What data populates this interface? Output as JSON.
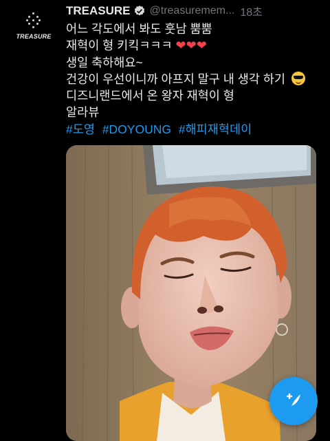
{
  "avatar": {
    "logo_text": "TREASURE"
  },
  "tweet": {
    "name": "TREASURE",
    "handle": "@treasuremem...",
    "time": "18초",
    "lines": [
      "어느 각도에서 봐도 훗남 뿜뿜",
      "재혁이 형 키킥ㅋㅋㅋ",
      "생일 축하해요~",
      "건강이 우선이니까 아프지 말구 내 생각 하기",
      "디즈니랜드에서 온 왕자 재혁이 형",
      "알라뷰"
    ],
    "hashtags": [
      "#도영",
      "#DOYOUNG",
      "#해피재혁데이"
    ]
  },
  "colors": {
    "accent": "#1d9bf0",
    "heart": "#f4414d",
    "background": "#000000"
  },
  "icons": [
    "verified-badge-icon",
    "heart-emoji-icon",
    "sunglasses-emoji-icon",
    "compose-tweet-icon"
  ]
}
